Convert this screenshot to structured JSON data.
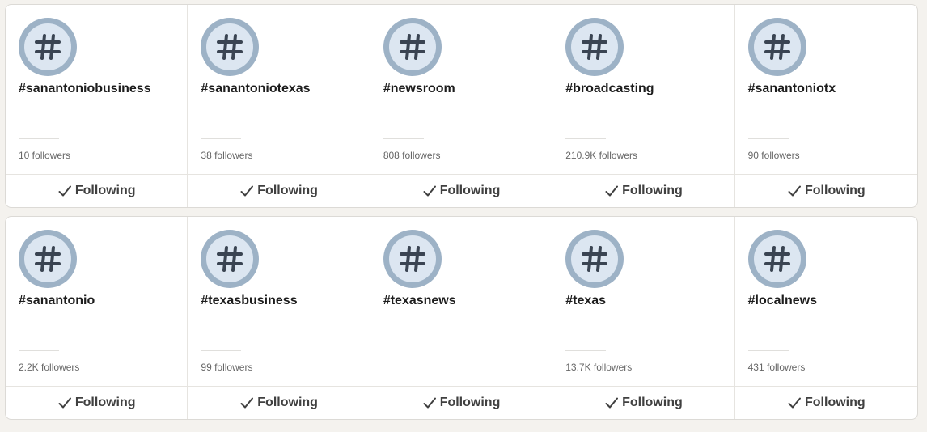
{
  "hashtags": [
    {
      "name": "#sanantoniobusiness",
      "followers": "10 followers",
      "button": "Following"
    },
    {
      "name": "#sanantoniotexas",
      "followers": "38 followers",
      "button": "Following"
    },
    {
      "name": "#newsroom",
      "followers": "808 followers",
      "button": "Following"
    },
    {
      "name": "#broadcasting",
      "followers": "210.9K followers",
      "button": "Following"
    },
    {
      "name": "#sanantoniotx",
      "followers": "90 followers",
      "button": "Following"
    },
    {
      "name": "#sanantonio",
      "followers": "2.2K followers",
      "button": "Following"
    },
    {
      "name": "#texasbusiness",
      "followers": "99 followers",
      "button": "Following"
    },
    {
      "name": "#texasnews",
      "followers": "",
      "button": "Following"
    },
    {
      "name": "#texas",
      "followers": "13.7K followers",
      "button": "Following"
    },
    {
      "name": "#localnews",
      "followers": "431 followers",
      "button": "Following"
    }
  ],
  "icons": {
    "hashtag": "hashtag-icon",
    "check": "check-icon"
  },
  "colors": {
    "icon_ring": "#9db2c6",
    "icon_fill": "#dce6f1",
    "icon_glyph": "#3a4452"
  }
}
